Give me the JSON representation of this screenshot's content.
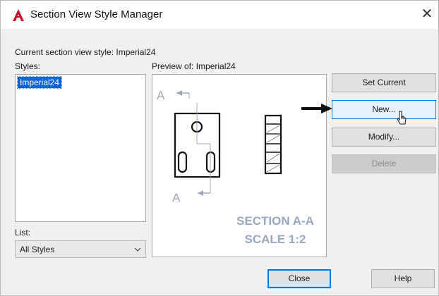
{
  "window": {
    "title": "Section View Style Manager",
    "app_icon": "autocad-icon",
    "close_glyph": "✕"
  },
  "current_style": {
    "label": "Current section view style: Imperial24"
  },
  "styles": {
    "label": "Styles:",
    "items": [
      "Imperial24"
    ],
    "selected": "Imperial24"
  },
  "preview": {
    "label": "Preview of: Imperial24",
    "view_marker_top": "A",
    "view_marker_bottom": "A",
    "caption_line1": "SECTION A-A",
    "caption_line2": "SCALE 1:2"
  },
  "list_filter": {
    "label": "List:",
    "value": "All Styles"
  },
  "buttons": {
    "set_current": "Set Current",
    "new": "New...",
    "modify": "Modify...",
    "delete": "Delete",
    "close": "Close",
    "help": "Help"
  },
  "colors": {
    "accent": "#0078d7",
    "selection": "#0a64d6",
    "app_icon_red": "#c8102e",
    "preview_caption": "#9aa9c0",
    "disabled_text": "#8a8a8a"
  }
}
